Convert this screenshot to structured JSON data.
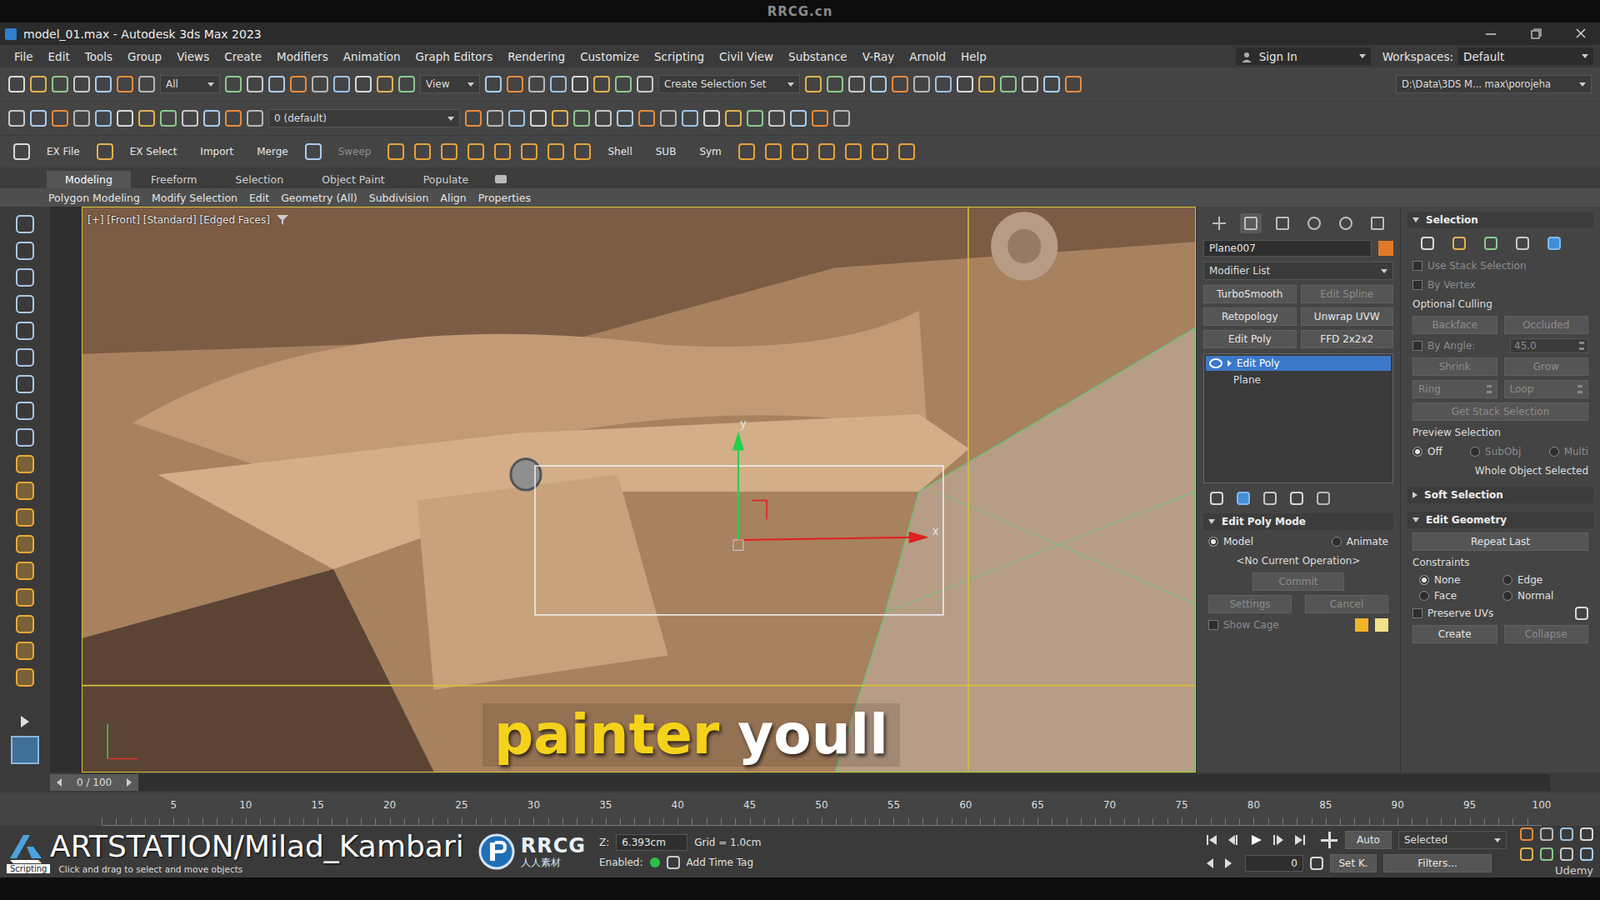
{
  "top_watermark": "RRCG.cn",
  "window": {
    "title": "model_01.max - Autodesk 3ds Max 2023"
  },
  "menu": [
    "File",
    "Edit",
    "Tools",
    "Group",
    "Views",
    "Create",
    "Modifiers",
    "Animation",
    "Graph Editors",
    "Rendering",
    "Customize",
    "Scripting",
    "Civil View",
    "Substance",
    "V-Ray",
    "Arnold",
    "Help"
  ],
  "sign_in": "Sign In",
  "workspaces": {
    "label": "Workspaces:",
    "value": "Default"
  },
  "toolbar": {
    "filter": "All",
    "coord_system": "View",
    "selection_set": "Create Selection Set",
    "project_path": "D:\\Data\\3DS M... max\\porojeha",
    "layer": "0 (default)"
  },
  "shortcuts": [
    {
      "label": "EX File",
      "disabled": false
    },
    {
      "label": "EX Select",
      "disabled": false
    },
    {
      "label": "Import",
      "disabled": false
    },
    {
      "label": "Merge",
      "disabled": false
    },
    {
      "label": "Sweep",
      "disabled": true
    },
    {
      "label": "Shell",
      "disabled": false
    },
    {
      "label": "SUB",
      "disabled": false
    },
    {
      "label": "Sym",
      "disabled": false
    }
  ],
  "ribbon_tabs": [
    {
      "label": "Modeling",
      "selected": true
    },
    {
      "label": "Freeform",
      "selected": false
    },
    {
      "label": "Selection",
      "selected": false
    },
    {
      "label": "Object Paint",
      "selected": false
    },
    {
      "label": "Populate",
      "selected": false
    }
  ],
  "ribbon_panels": [
    "Polygon Modeling",
    "Modify Selection",
    "Edit",
    "Geometry (All)",
    "Subdivision",
    "Align",
    "Properties"
  ],
  "viewport": {
    "label": "[+] [Front] [Standard] [Edged Faces]",
    "gizmo": {
      "x": "x",
      "y": "y"
    },
    "caption": [
      {
        "text": "painter",
        "color": "#f5d21a"
      },
      {
        "text": "youll",
        "color": "#ffffff"
      }
    ]
  },
  "command_panel": {
    "tabs": [
      {
        "kind": "create",
        "selected": false
      },
      {
        "kind": "modify",
        "selected": true
      },
      {
        "kind": "hierarchy",
        "selected": false
      },
      {
        "kind": "motion",
        "selected": false
      },
      {
        "kind": "display",
        "selected": false
      },
      {
        "kind": "utilities",
        "selected": false
      }
    ],
    "object_name": "Plane007",
    "object_color": "#e07a2a",
    "modifier_list": "Modifier List",
    "modifiers": [
      {
        "label": "TurboSmooth",
        "disabled": false
      },
      {
        "label": "Edit Spline",
        "disabled": true
      },
      {
        "label": "Retopology",
        "disabled": false
      },
      {
        "label": "Unwrap UVW",
        "disabled": false
      },
      {
        "label": "Edit Poly",
        "disabled": false
      },
      {
        "label": "FFD 2x2x2",
        "disabled": false
      }
    ],
    "stack": [
      {
        "label": "Edit Poly",
        "selected": true,
        "visible": true,
        "expandable": true
      },
      {
        "label": "Plane",
        "selected": false,
        "visible": false,
        "expandable": false
      }
    ],
    "edit_poly_mode": {
      "title": "Edit Poly Mode",
      "expanded": true,
      "modes": [
        {
          "label": "Model",
          "selected": true
        },
        {
          "label": "Animate",
          "selected": false
        }
      ],
      "operation": "<No Current Operation>",
      "commit": {
        "label": "Commit",
        "disabled": true
      },
      "settings": {
        "label": "Settings",
        "disabled": true
      },
      "cancel": {
        "label": "Cancel",
        "disabled": true
      },
      "show_cage": {
        "label": "Show Cage",
        "checked": false,
        "disabled": true
      },
      "cage_colors": [
        "#f0b429",
        "#f3e08a"
      ]
    }
  },
  "selection_rollout": {
    "title": "Selection",
    "expanded": true,
    "use_stack": {
      "label": "Use Stack Selection",
      "checked": false,
      "disabled": true
    },
    "by_vertex": {
      "label": "By Vertex",
      "checked": false,
      "disabled": true
    },
    "culling": {
      "label": "Optional Culling",
      "options": [
        {
          "label": "Backface",
          "disabled": true
        },
        {
          "label": "Occluded",
          "disabled": true
        }
      ]
    },
    "by_angle": {
      "label": "By Angle:",
      "value": "45.0",
      "checked": false,
      "disabled": true
    },
    "grow_shrink": [
      {
        "label": "Shrink",
        "disabled": true
      },
      {
        "label": "Grow",
        "disabled": true
      }
    ],
    "ring_loop": [
      {
        "label": "Ring",
        "disabled": true
      },
      {
        "label": "Loop",
        "disabled": true
      }
    ],
    "get_stack": {
      "label": "Get Stack Selection",
      "disabled": true
    },
    "preview": {
      "label": "Preview Selection",
      "options": [
        {
          "label": "Off",
          "selected": true,
          "disabled": false
        },
        {
          "label": "SubObj",
          "selected": false,
          "disabled": true
        },
        {
          "label": "Multi",
          "selected": false,
          "disabled": true
        }
      ]
    },
    "status": "Whole Object Selected"
  },
  "soft_selection": {
    "title": "Soft Selection",
    "expanded": false
  },
  "edit_geometry": {
    "title": "Edit Geometry",
    "expanded": true,
    "repeat": "Repeat Last",
    "constraints": {
      "label": "Constraints",
      "options": [
        {
          "label": "None",
          "selected": true
        },
        {
          "label": "Edge",
          "selected": false
        },
        {
          "label": "Face",
          "selected": false
        },
        {
          "label": "Normal",
          "selected": false
        }
      ]
    },
    "preserve_uvs": {
      "label": "Preserve UVs",
      "checked": false
    },
    "buttons": [
      {
        "label": "Create",
        "disabled": false
      },
      {
        "label": "Collapse",
        "disabled": true
      }
    ]
  },
  "timeline": {
    "position": "0 / 100",
    "level": 0,
    "ticks": [
      "5",
      "10",
      "15",
      "20",
      "25",
      "30",
      "35",
      "40",
      "45",
      "50",
      "55",
      "60",
      "65",
      "70",
      "75",
      "80",
      "85",
      "90",
      "95",
      "100"
    ]
  },
  "status_bar": {
    "watermark": "ARTSTATION/Milad_Kambari",
    "script_label": "Scripting",
    "prompt": "Click and drag to select and move objects",
    "logo": {
      "name": "RRCG",
      "sub": "人人素材"
    },
    "z": {
      "label": "Z:",
      "value": "6.393cm"
    },
    "grid": "Grid = 1.0cm",
    "enabled": {
      "label": "Enabled:",
      "on": true
    },
    "time_tag": "Add Time Tag",
    "auto": "Auto",
    "set_key": "Set K.",
    "key_filter": "Selected",
    "filters": "Filters...",
    "frame": "0",
    "udemy": "Udemy"
  }
}
